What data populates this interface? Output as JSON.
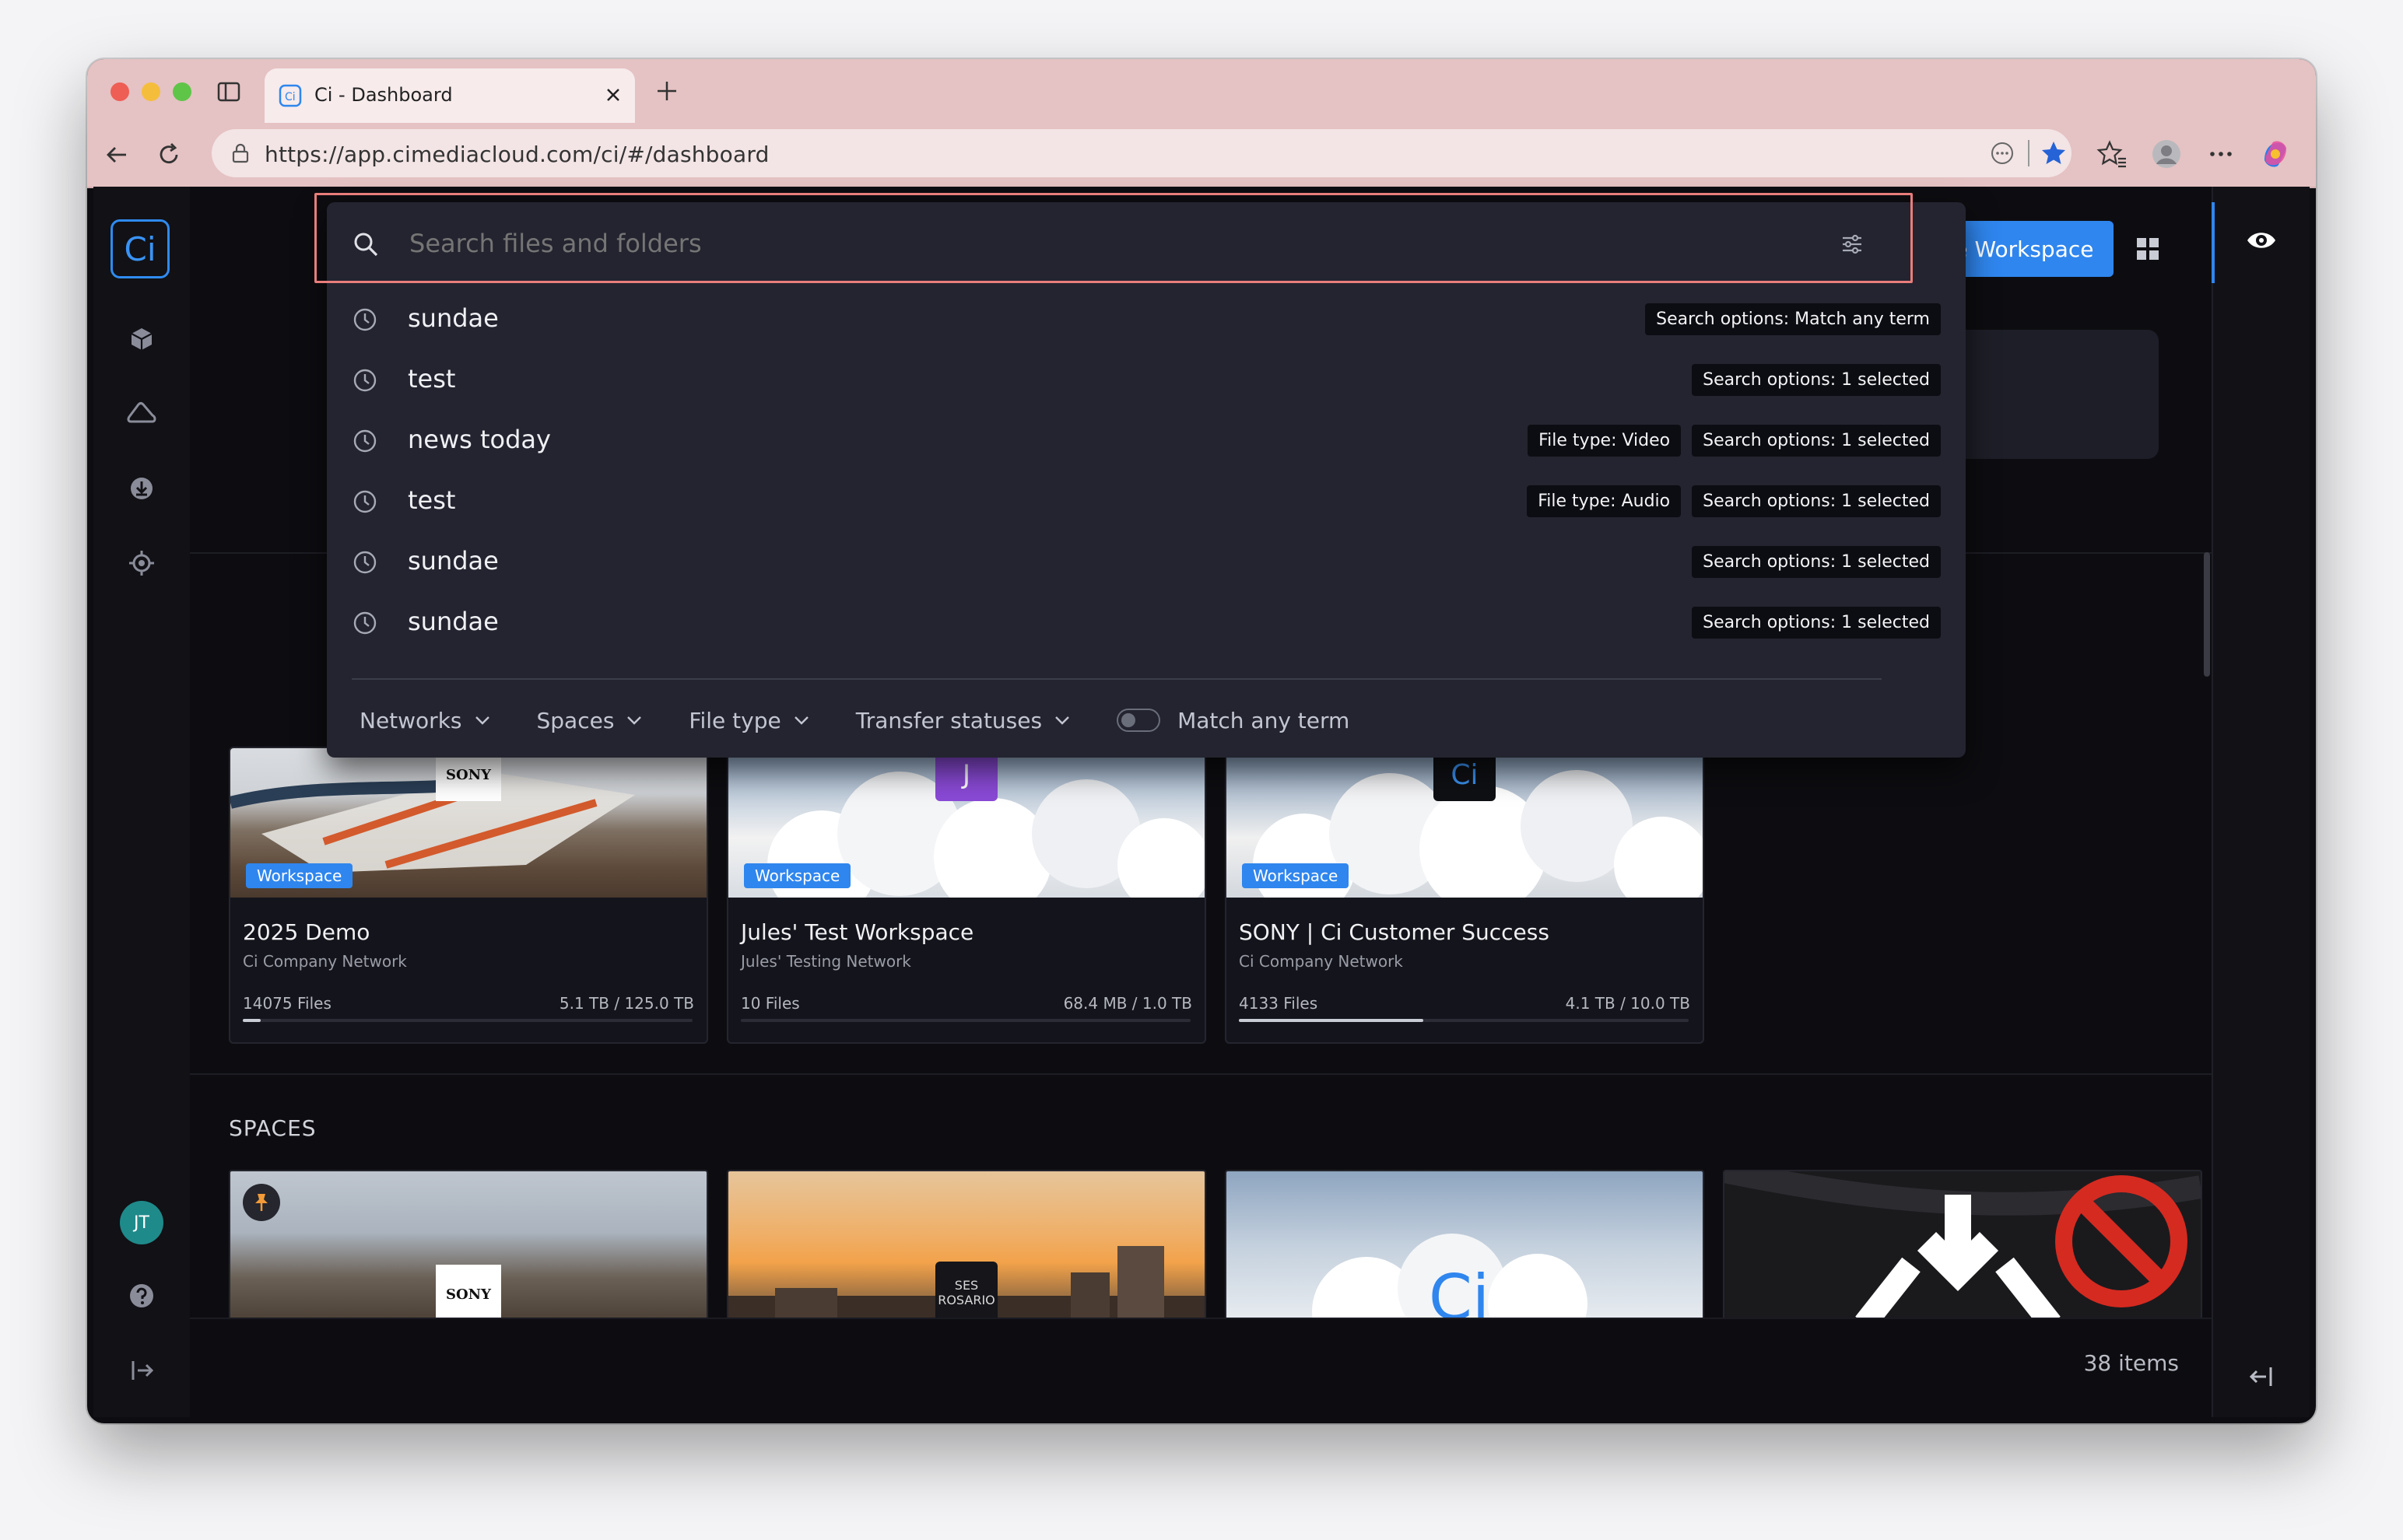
{
  "browser": {
    "tab_title": "Ci - Dashboard",
    "url": "https://app.cimediacloud.com/ci/#/dashboard"
  },
  "colors": {
    "accent": "#2f86ee",
    "titlebar": "#e5c2c3",
    "app_bg": "#0d0d11",
    "panel_bg": "#23242f",
    "search_highlight": "#e97d7b"
  },
  "sidebar": {
    "logo_text": "Ci",
    "icons": [
      "cube-icon",
      "cloud-icon",
      "download-icon",
      "target-icon"
    ],
    "avatar_initials": "JT",
    "help_icon": "help-icon",
    "logout_icon": "sign-out-icon"
  },
  "header": {
    "create_button_label": "Create Workspace",
    "view_icon": "grid-icon",
    "eye_icon": "eye-icon"
  },
  "search": {
    "placeholder": "Search files and folders",
    "history": [
      {
        "term": "sundae",
        "tags": [
          "Search options: Match any term"
        ]
      },
      {
        "term": "test",
        "tags": [
          "Search options: 1 selected"
        ]
      },
      {
        "term": "news today",
        "tags": [
          "File type: Video",
          "Search options: 1 selected"
        ]
      },
      {
        "term": "test",
        "tags": [
          "File type: Audio",
          "Search options: 1 selected"
        ]
      },
      {
        "term": "sundae",
        "tags": [
          "Search options: 1 selected"
        ]
      },
      {
        "term": "sundae",
        "tags": [
          "Search options: 1 selected"
        ]
      }
    ],
    "filters": [
      "Networks",
      "Spaces",
      "File type",
      "Transfer statuses"
    ],
    "match_any_term_label": "Match any term",
    "match_any_term_enabled": false
  },
  "workspaces": [
    {
      "badge": "Workspace",
      "title": "2025 Demo",
      "network": "Ci Company Network",
      "files": "14075 Files",
      "size": "5.1 TB / 125.0 TB",
      "usage": 0.04,
      "logo": "SONY"
    },
    {
      "badge": "Workspace",
      "title": "Jules' Test Workspace",
      "network": "Jules' Testing Network",
      "files": "10 Files",
      "size": "68.4 MB / 1.0 TB",
      "usage": 0.0,
      "logo": "J"
    },
    {
      "badge": "Workspace",
      "title": "SONY | Ci Customer Success",
      "network": "Ci Company Network",
      "files": "4133 Files",
      "size": "4.1 TB / 10.0 TB",
      "usage": 0.41,
      "logo": "Ci"
    }
  ],
  "spaces": {
    "heading": "SPACES",
    "items": [
      {
        "logo": "SONY",
        "pinned": true
      },
      {
        "logo": "SES ROSARIO"
      },
      {
        "logo": "Ci"
      },
      {
        "logo": "no-download"
      }
    ]
  },
  "footer": {
    "item_count": "38 items"
  }
}
